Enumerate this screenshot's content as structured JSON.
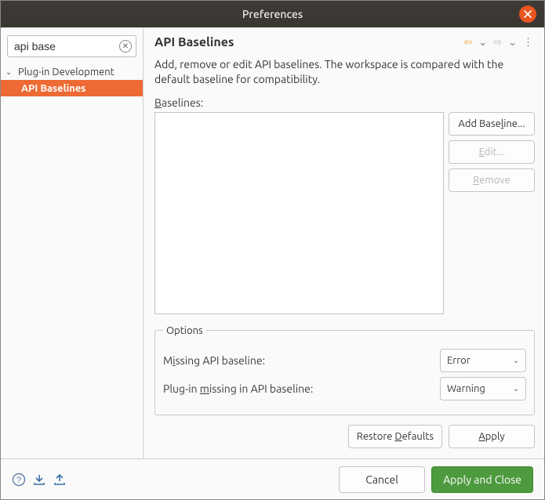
{
  "title": "Preferences",
  "search": {
    "value": "api base"
  },
  "tree": {
    "parent": "Plug-in Development",
    "child": "API Baselines"
  },
  "page": {
    "title": "API Baselines",
    "description": "Add, remove or edit API baselines. The workspace is compared with the default baseline for compatibility.",
    "baselines_label_pre": "B",
    "baselines_label_post": "aselines:"
  },
  "buttons": {
    "add": "Add Baseline...",
    "edit": "Edit...",
    "remove": "Remove",
    "restore": "Restore Defaults",
    "apply": "Apply",
    "cancel": "Cancel",
    "apply_close": "Apply and Close"
  },
  "options": {
    "legend": "Options",
    "missing_label": "Missing API baseline:",
    "missing_value": "Error",
    "plugin_missing_label_pre": "Plug-in ",
    "plugin_missing_label_mn": "m",
    "plugin_missing_label_post": "issing in API baseline:",
    "plugin_missing_value": "Warning"
  }
}
